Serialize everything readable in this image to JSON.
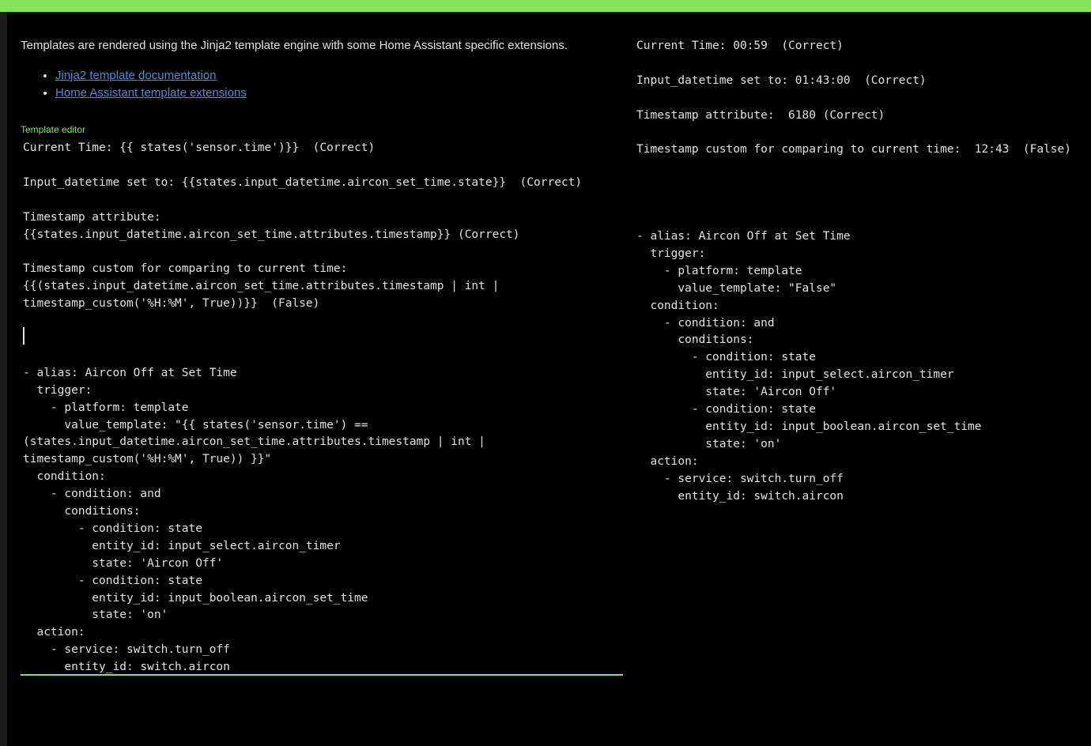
{
  "colors": {
    "accent": "#84e35a",
    "link": "#4f8ad9",
    "text": "#e1e1e1",
    "background": "#000000"
  },
  "intro": {
    "text": "Templates are rendered using the Jinja2 template engine with some Home Assistant specific extensions."
  },
  "links": [
    {
      "label": "Jinja2 template documentation"
    },
    {
      "label": "Home Assistant template extensions"
    }
  ],
  "editor": {
    "label": "Template editor",
    "content": "Current Time: {{ states('sensor.time')}}  (Correct)\n\nInput_datetime set to: {{states.input_datetime.aircon_set_time.state}}  (Correct)\n\nTimestamp attribute:\n{{states.input_datetime.aircon_set_time.attributes.timestamp}} (Correct)\n\nTimestamp custom for comparing to current time:\n{{(states.input_datetime.aircon_set_time.attributes.timestamp | int |\ntimestamp_custom('%H:%M', True))}}  (False)\n\n\n\n- alias: Aircon Off at Set Time\n  trigger:\n    - platform: template\n      value_template: \"{{ states('sensor.time') ==\n(states.input_datetime.aircon_set_time.attributes.timestamp | int |\ntimestamp_custom('%H:%M', True)) }}\"\n  condition:\n    - condition: and\n      conditions:\n        - condition: state\n          entity_id: input_select.aircon_timer\n          state: 'Aircon Off'\n        - condition: state\n          entity_id: input_boolean.aircon_set_time\n          state: 'on'\n  action:\n    - service: switch.turn_off\n      entity_id: switch.aircon"
  },
  "result": {
    "content": "Current Time: 00:59  (Correct)\n\nInput_datetime set to: 01:43:00  (Correct)\n\nTimestamp attribute:  6180 (Correct)\n\nTimestamp custom for comparing to current time:  12:43  (False)\n\n\n\n\n- alias: Aircon Off at Set Time\n  trigger:\n    - platform: template\n      value_template: \"False\"\n  condition:\n    - condition: and\n      conditions:\n        - condition: state\n          entity_id: input_select.aircon_timer\n          state: 'Aircon Off'\n        - condition: state\n          entity_id: input_boolean.aircon_set_time\n          state: 'on'\n  action:\n    - service: switch.turn_off\n      entity_id: switch.aircon"
  }
}
